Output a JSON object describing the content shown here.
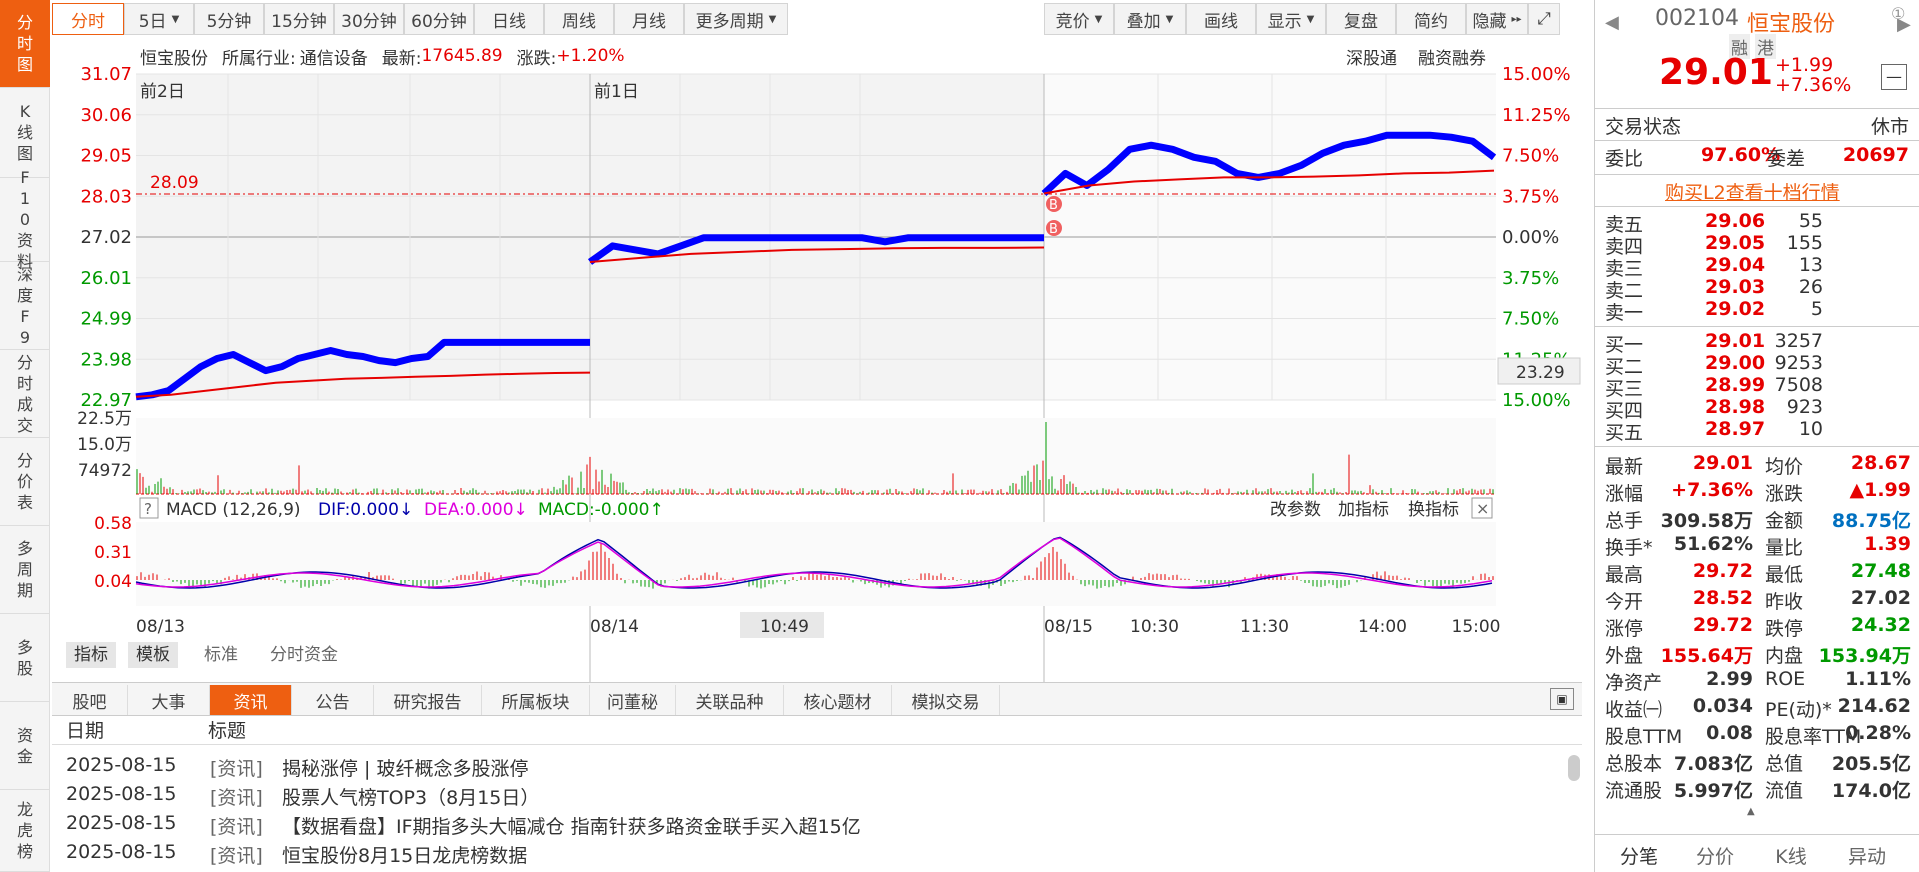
{
  "nav": [
    {
      "label": "分时图",
      "active": true
    },
    {
      "label": "K线图"
    },
    {
      "label": "F10资料"
    },
    {
      "label": "深度F9"
    },
    {
      "label": "分时成交"
    },
    {
      "label": "分价表"
    },
    {
      "label": "多周期"
    },
    {
      "label": "多股"
    },
    {
      "label": "资金"
    },
    {
      "label": "龙虎榜"
    }
  ],
  "toolbar": {
    "periods": [
      "分时",
      "5日",
      "5分钟",
      "15分钟",
      "30分钟",
      "60分钟",
      "日线",
      "周线",
      "月线",
      "更多周期"
    ],
    "tools": [
      "竞价",
      "叠加",
      "画线",
      "显示",
      "复盘",
      "简约",
      "隐藏"
    ]
  },
  "info": {
    "name": "恒宝股份",
    "industry_label": "所属行业:",
    "industry": "通信设备",
    "latest_label": "最新:",
    "latest": "17645.89",
    "chg_label": "涨跌:",
    "chg": "+1.20%",
    "links": [
      "深股通",
      "融资融券"
    ]
  },
  "chart": {
    "day_labels": [
      "前2日",
      "前1日"
    ],
    "price_axis": [
      "31.07",
      "30.06",
      "29.05",
      "28.03",
      "27.02",
      "26.01",
      "24.99",
      "23.98",
      "22.97"
    ],
    "pct_axis": [
      "15.00%",
      "11.25%",
      "7.50%",
      "3.75%",
      "0.00%",
      "3.75%",
      "7.50%",
      "11.25%",
      "15.00%"
    ],
    "ref_price": "28.09",
    "cursor_price": "23.29",
    "vol_axis": [
      "22.5万",
      "15.0万",
      "74972"
    ],
    "macd": {
      "help": "?",
      "title": "MACD (12,26,9)",
      "dif": "DIF:0.000↓",
      "dea": "DEA:0.000↓",
      "macd": "MACD:-0.000↑",
      "buttons": [
        "改参数",
        "加指标",
        "换指标"
      ],
      "close": "×",
      "axis": [
        "0.58",
        "0.31",
        "0.04"
      ]
    },
    "time_axis": [
      "08/13",
      "08/14",
      "08/15",
      "10:30",
      "11:30",
      "14:00",
      "15:00"
    ],
    "cursor_time": "10:49",
    "trade_marks": [
      "B",
      "B"
    ],
    "subtabs": [
      "指标",
      "模板",
      "标准",
      "分时资金"
    ],
    "price_color": "#0000ff",
    "avg_color": "#e60000"
  },
  "news": {
    "tabs": [
      "股吧",
      "大事",
      "资讯",
      "公告",
      "研究报告",
      "所属板块",
      "问董秘",
      "关联品种",
      "核心题材",
      "模拟交易"
    ],
    "active": "资讯",
    "head_date": "日期",
    "head_title": "标题",
    "rows": [
      {
        "date": "2025-08-15",
        "tag": "[资讯]",
        "title": "揭秘涨停 | 玻纤概念多股涨停"
      },
      {
        "date": "2025-08-15",
        "tag": "[资讯]",
        "title": "股票人气榜TOP3（8月15日）"
      },
      {
        "date": "2025-08-15",
        "tag": "[资讯]",
        "title": "【数据看盘】IF期指多头大幅减仓 指南针获多路资金联手买入超15亿"
      },
      {
        "date": "2025-08-15",
        "tag": "[资讯]",
        "title": "恒宝股份8月15日龙虎榜数据"
      }
    ]
  },
  "quote": {
    "code": "002104",
    "name": "恒宝股份",
    "circle": "①",
    "badges": [
      "融",
      "港"
    ],
    "price": "29.01",
    "chg": "+1.99",
    "pct": "+7.36%",
    "status_label": "交易状态",
    "status": "休市",
    "wb_label": "委比",
    "wb": "97.60%",
    "wc_label": "委差",
    "wc": "20697",
    "l2": "购买L2查看十档行情",
    "asks": [
      [
        "卖五",
        "29.06",
        "55"
      ],
      [
        "卖四",
        "29.05",
        "155"
      ],
      [
        "卖三",
        "29.04",
        "13"
      ],
      [
        "卖二",
        "29.03",
        "26"
      ],
      [
        "卖一",
        "29.02",
        "5"
      ]
    ],
    "bids": [
      [
        "买一",
        "29.01",
        "3257"
      ],
      [
        "买二",
        "29.00",
        "9253"
      ],
      [
        "买三",
        "28.99",
        "7508"
      ],
      [
        "买四",
        "28.98",
        "923"
      ],
      [
        "买五",
        "28.97",
        "10"
      ]
    ],
    "stats": [
      [
        "最新",
        "29.01",
        "均价",
        "28.67"
      ],
      [
        "涨幅",
        "+7.36%",
        "涨跌",
        "▲1.99"
      ],
      [
        "总手",
        "309.58万",
        "金额",
        "88.75亿"
      ],
      [
        "换手*",
        "51.62%",
        "量比",
        "1.39"
      ],
      [
        "最高",
        "29.72",
        "最低",
        "27.48"
      ],
      [
        "今开",
        "28.52",
        "昨收",
        "27.02"
      ],
      [
        "涨停",
        "29.72",
        "跌停",
        "24.32"
      ],
      [
        "外盘",
        "155.64万",
        "内盘",
        "153.94万"
      ],
      [
        "净资产",
        "2.99",
        "ROE",
        "1.11%"
      ],
      [
        "收益㈠",
        "0.034",
        "PE(动)*",
        "214.62"
      ],
      [
        "股息TTM",
        "0.08",
        "股息率TTM",
        "0.28%"
      ],
      [
        "总股本",
        "7.083亿",
        "总值",
        "205.5亿"
      ],
      [
        "流通股",
        "5.997亿",
        "流值",
        "174.0亿"
      ]
    ],
    "bottom_tabs": [
      "分笔",
      "分价",
      "K线",
      "异动"
    ]
  }
}
